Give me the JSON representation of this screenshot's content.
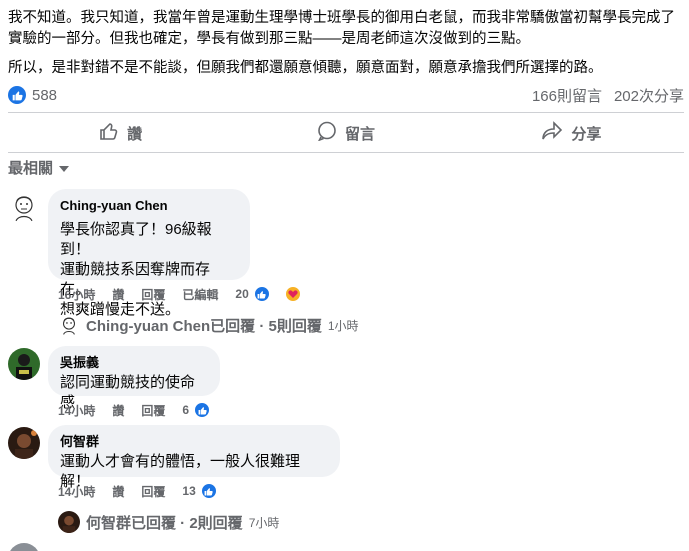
{
  "post": {
    "paragraph1": "我不知道。我只知道，我當年曾是運動生理學博士班學長的御用白老鼠，而我非常驕傲當初幫學長完成了實驗的一部分。但我也確定，學長有做到那三點——是周老師這次沒做到的三點。",
    "paragraph2": "所以，是非對錯不是不能談，但願我們都還願意傾聽，願意面對，願意承擔我們所選擇的路。"
  },
  "stats": {
    "likes": "588",
    "comments": "166則留言",
    "shares": "202次分享"
  },
  "actions": {
    "like": "讚",
    "comment": "留言",
    "share": "分享"
  },
  "sort": {
    "label": "最相關"
  },
  "comments": [
    {
      "name": "Ching-yuan Chen",
      "lines": [
        "學長你認真了！96級報到！",
        "運動競技系因奪牌而存在。",
        "想爽蹭慢走不送。"
      ],
      "time": "16小時",
      "like": "讚",
      "reply": "回覆",
      "edited": "已編輯",
      "reactions": "20",
      "replies_label": "Ching-yuan Chen已回覆 · 5則回覆",
      "replies_time": "1小時"
    },
    {
      "name": "吳振義",
      "lines": [
        "認同運動競技的使命感"
      ],
      "time": "14小時",
      "like": "讚",
      "reply": "回覆",
      "reactions": "6"
    },
    {
      "name": "何智群",
      "lines": [
        "運動人才會有的體悟，一般人很難理解！"
      ],
      "time": "14小時",
      "like": "讚",
      "reply": "回覆",
      "reactions": "13",
      "replies_label": "何智群已回覆 · 2則回覆",
      "replies_time": "7小時"
    }
  ],
  "colors": {
    "accent": "#1b74e4",
    "bubble": "#f0f2f5",
    "muted": "#65676b"
  }
}
